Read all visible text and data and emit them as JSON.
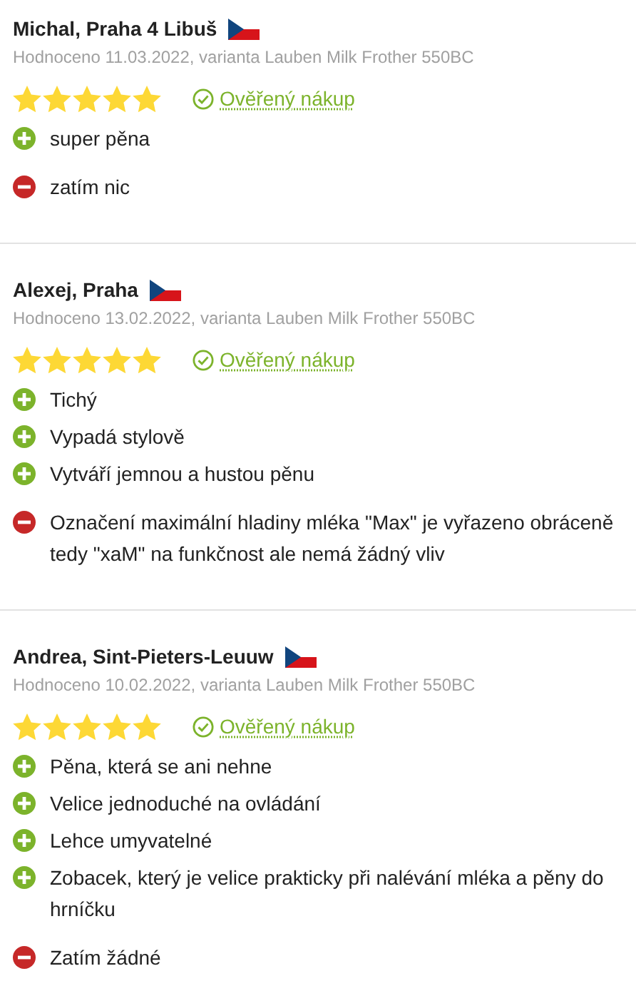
{
  "reviews": [
    {
      "author": "Michal, Praha 4 Libuš",
      "meta": "Hodnoceno 11.03.2022, varianta Lauben Milk Frother 550BC",
      "stars": 5,
      "verified": "Ověřený nákup",
      "points": [
        {
          "kind": "pro",
          "text": "super pěna"
        },
        {
          "kind": "con",
          "text": "zatím nic"
        }
      ]
    },
    {
      "author": "Alexej, Praha",
      "meta": "Hodnoceno 13.02.2022, varianta Lauben Milk Frother 550BC",
      "stars": 5,
      "verified": "Ověřený nákup",
      "points": [
        {
          "kind": "pro",
          "text": "Tichý"
        },
        {
          "kind": "pro",
          "text": "Vypadá stylově"
        },
        {
          "kind": "pro",
          "text": "Vytváří jemnou a hustou pěnu"
        },
        {
          "kind": "con",
          "text": "Označení maximální hladiny mléka \"Max\" je vyřazeno obráceně tedy \"xaM\" na funkčnost ale nemá žádný vliv"
        }
      ]
    },
    {
      "author": "Andrea, Sint-Pieters-Leuuw",
      "meta": "Hodnoceno 10.02.2022, varianta Lauben Milk Frother 550BC",
      "stars": 5,
      "verified": "Ověřený nákup",
      "points": [
        {
          "kind": "pro",
          "text": "Pěna, která se ani nehne"
        },
        {
          "kind": "pro",
          "text": "Velice jednoduché na ovládání"
        },
        {
          "kind": "pro",
          "text": "Lehce umyvatelné"
        },
        {
          "kind": "pro",
          "text": "Zobacek, který je velice prakticky při nalévání mléka a pěny do hrníčku"
        },
        {
          "kind": "con",
          "text": "Zatím žádné"
        }
      ]
    }
  ]
}
